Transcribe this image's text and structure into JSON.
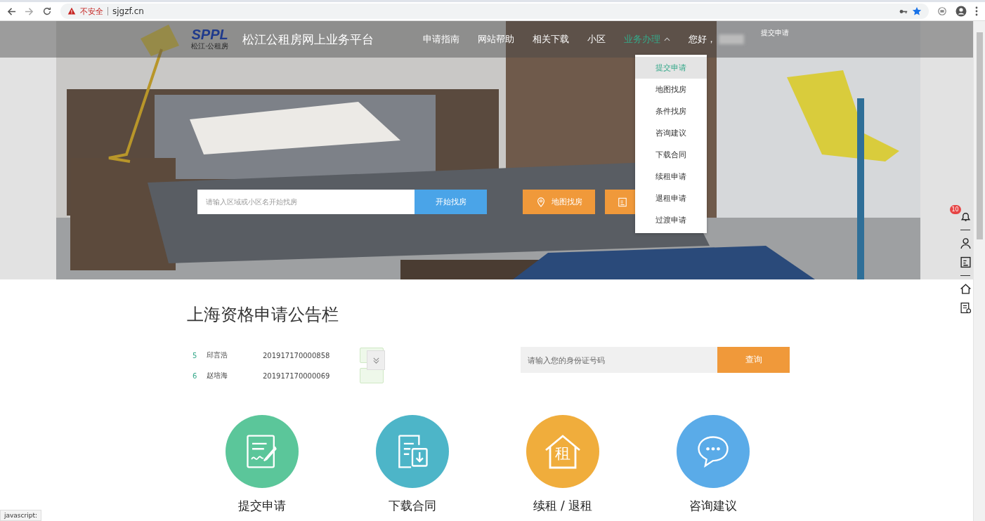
{
  "browser": {
    "security": "不安全",
    "url": "sjgzf.cn",
    "status": "javascript:"
  },
  "header": {
    "logo": "SPPL",
    "logo_sub": "松江·公租房",
    "site_title": "松江公租房网上业务平台",
    "nav": [
      {
        "label": "申请指南",
        "selected": false,
        "dropdown": false
      },
      {
        "label": "网站帮助",
        "selected": false,
        "dropdown": false
      },
      {
        "label": "相关下载",
        "selected": false,
        "dropdown": false
      },
      {
        "label": "小区",
        "selected": false,
        "dropdown": false
      },
      {
        "label": "业务办理",
        "selected": true,
        "dropdown": true
      }
    ],
    "greeting": "您好，",
    "corner_link": "提交申请"
  },
  "dropdown": {
    "expanded": true,
    "items": [
      {
        "label": "提交申请",
        "selected": true
      },
      {
        "label": "地图找房",
        "selected": false
      },
      {
        "label": "条件找房",
        "selected": false
      },
      {
        "label": "咨询建议",
        "selected": false
      },
      {
        "label": "下载合同",
        "selected": false
      },
      {
        "label": "续租申请",
        "selected": false
      },
      {
        "label": "退租申请",
        "selected": false
      },
      {
        "label": "过渡申请",
        "selected": false
      }
    ]
  },
  "hero_search": {
    "placeholder": "请输入区域或小区名开始找房",
    "button": "开始找房",
    "map_button": "地图找房"
  },
  "notice": {
    "title": "上海资格申请公告栏",
    "rows": [
      {
        "index": "5",
        "name": "邱言浩",
        "number": "201917170000858"
      },
      {
        "index": "6",
        "name": "赵培海",
        "number": "201917170000069"
      }
    ],
    "id_search": {
      "placeholder": "请输入您的身份证号码",
      "button": "查询"
    }
  },
  "services": [
    {
      "kind": "apply",
      "label": "提交申请",
      "color": "#5bc69a"
    },
    {
      "kind": "contract",
      "label": "下载合同",
      "color": "#4db5c8"
    },
    {
      "kind": "rent",
      "label": "续租 / 退租",
      "color": "#f0ad3c",
      "icon_text": "租"
    },
    {
      "kind": "advice",
      "label": "咨询建议",
      "color": "#5aabe8"
    }
  ],
  "side_toolbar": {
    "badge": "10"
  }
}
